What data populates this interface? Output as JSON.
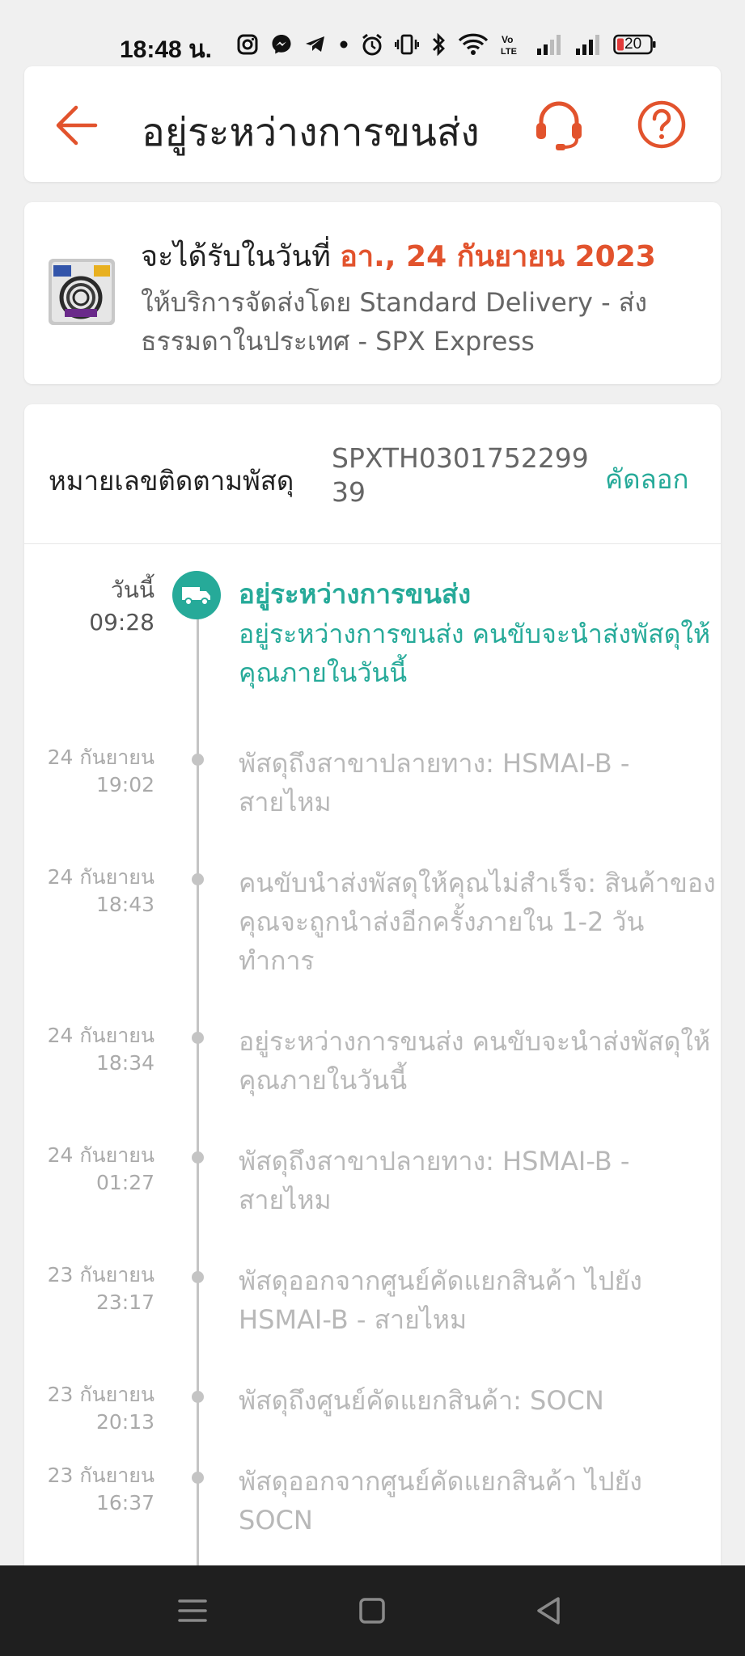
{
  "status_bar": {
    "time": "18:48 น.",
    "battery": "20",
    "icons": [
      "instagram-icon",
      "messenger-icon",
      "telegram-icon",
      "dot-icon",
      "alarm-icon",
      "vibrate-icon",
      "bluetooth-icon",
      "wifi-icon",
      "volte-icon",
      "signal-icon",
      "signal-icon",
      "battery-icon"
    ]
  },
  "header": {
    "title": "อยู่ระหว่างการขนส่ง",
    "back_icon": "arrow-left-icon",
    "support_icon": "headset-icon",
    "help_icon": "question-circle-icon"
  },
  "estimate": {
    "label": "จะได้รับในวันที่ ",
    "date": "อา., 24 กันยายน 2023",
    "service": "ให้บริการจัดส่งโดย Standard Delivery - ส่งธรรมดาในประเทศ - SPX Express"
  },
  "tracking": {
    "label": "หมายเลขติดตามพัสดุ",
    "number": "SPXTH030175229939",
    "copy_label": "คัดลอก"
  },
  "events": [
    {
      "date": "วันนี้",
      "time": "09:28",
      "title": "อยู่ระหว่างการขนส่ง",
      "description": "อยู่ระหว่างการขนส่ง คนขับจะนำส่งพัสดุให้คุณภายในวันนี้"
    },
    {
      "date": "24 กันยายน",
      "time": "19:02",
      "description": "พัสดุถึงสาขาปลายทาง: HSMAI-B - สายไหม"
    },
    {
      "date": "24 กันยายน",
      "time": "18:43",
      "description": "คนขับนำส่งพัสดุให้คุณไม่สำเร็จ: สินค้าของคุณจะถูกนำส่งอีกครั้งภายใน 1-2 วันทำการ"
    },
    {
      "date": "24 กันยายน",
      "time": "18:34",
      "description": "อยู่ระหว่างการขนส่ง คนขับจะนำส่งพัสดุให้คุณภายในวันนี้"
    },
    {
      "date": "24 กันยายน",
      "time": "01:27",
      "description": "พัสดุถึงสาขาปลายทาง: HSMAI-B - สายไหม"
    },
    {
      "date": "23 กันยายน",
      "time": "23:17",
      "description": "พัสดุออกจากศูนย์คัดแยกสินค้า ไปยัง HSMAI-B - สายไหม"
    },
    {
      "date": "23 กันยายน",
      "time": "20:13",
      "description": "พัสดุถึงศูนย์คัดแยกสินค้า: SOCN"
    },
    {
      "date": "23 กันยายน",
      "time": "16:37",
      "description": "พัสดุออกจากศูนย์คัดแยกสินค้า ไปยัง SOCN"
    }
  ],
  "nav": {
    "menu_icon": "menu-icon",
    "home_icon": "home-square-icon",
    "back_icon": "back-triangle-icon"
  },
  "colors": {
    "accent": "#e2532d",
    "teal": "#26aa99",
    "muted": "#b8b8b8"
  }
}
